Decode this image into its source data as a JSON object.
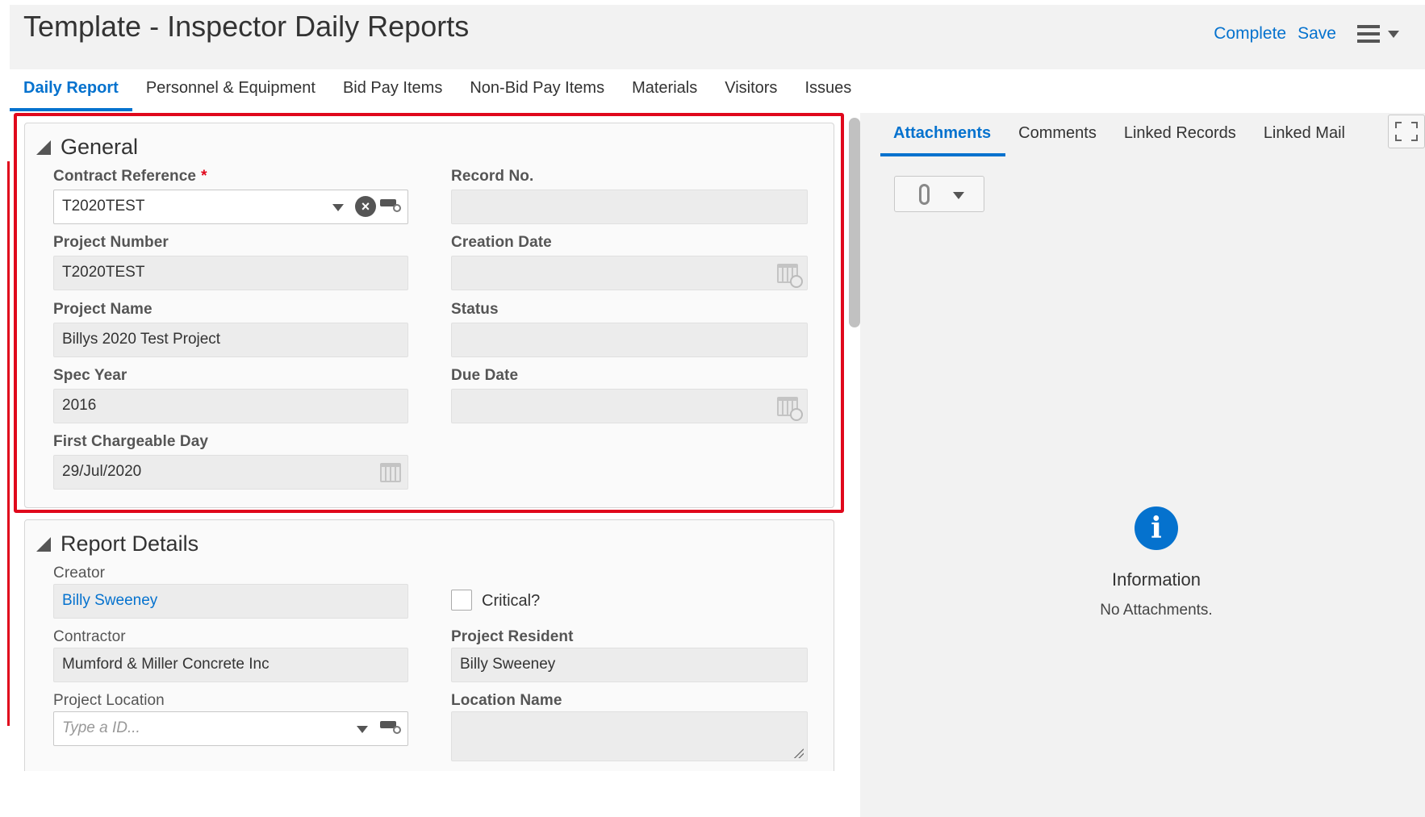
{
  "header": {
    "title": "Template - Inspector Daily Reports",
    "complete_label": "Complete",
    "save_label": "Save"
  },
  "main_tabs": [
    {
      "label": "Daily Report",
      "active": true
    },
    {
      "label": "Personnel & Equipment",
      "active": false
    },
    {
      "label": "Bid Pay Items",
      "active": false
    },
    {
      "label": "Non-Bid Pay Items",
      "active": false
    },
    {
      "label": "Materials",
      "active": false
    },
    {
      "label": "Visitors",
      "active": false
    },
    {
      "label": "Issues",
      "active": false
    }
  ],
  "general": {
    "title": "General",
    "contract_reference": {
      "label": "Contract Reference",
      "required_mark": "*",
      "value": "T2020TEST"
    },
    "record_no": {
      "label": "Record No.",
      "value": ""
    },
    "project_number": {
      "label": "Project Number",
      "value": "T2020TEST"
    },
    "creation_date": {
      "label": "Creation Date",
      "value": ""
    },
    "project_name": {
      "label": "Project Name",
      "value": "Billys 2020 Test Project"
    },
    "status": {
      "label": "Status",
      "value": ""
    },
    "spec_year": {
      "label": "Spec Year",
      "value": "2016"
    },
    "due_date": {
      "label": "Due Date",
      "value": ""
    },
    "first_chargeable_day": {
      "label": "First Chargeable Day",
      "value": "29/Jul/2020"
    }
  },
  "report_details": {
    "title": "Report Details",
    "creator": {
      "label": "Creator",
      "value": "Billy Sweeney"
    },
    "critical": {
      "label": "Critical?",
      "checked": false
    },
    "contractor": {
      "label": "Contractor",
      "value": "Mumford & Miller Concrete Inc"
    },
    "project_resident": {
      "label": "Project Resident",
      "value": "Billy Sweeney"
    },
    "project_location": {
      "label": "Project Location",
      "placeholder": "Type a ID..."
    },
    "location_name": {
      "label": "Location Name",
      "value": ""
    }
  },
  "side_panel": {
    "tabs": [
      {
        "label": "Attachments",
        "active": true
      },
      {
        "label": "Comments",
        "active": false
      },
      {
        "label": "Linked Records",
        "active": false
      },
      {
        "label": "Linked Mail",
        "active": false
      }
    ],
    "info_title": "Information",
    "info_message": "No Attachments."
  },
  "colors": {
    "accent": "#0572ce",
    "highlight": "#e0081c",
    "header_bg": "#f2f2f2"
  },
  "icons": [
    "clear-icon",
    "tag-icon",
    "calendar-icon",
    "hamburger-icon",
    "chevron-down-icon",
    "paperclip-icon",
    "info-icon",
    "expand-icon"
  ]
}
